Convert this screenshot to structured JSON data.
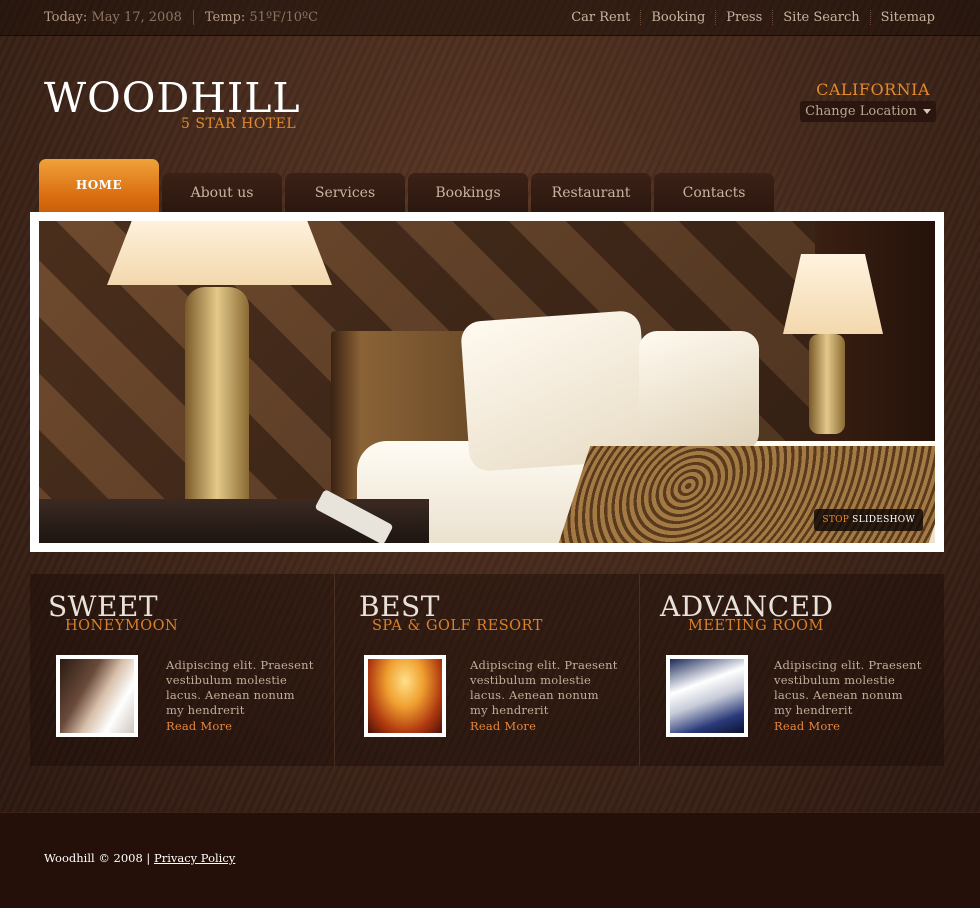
{
  "topbar": {
    "today_label": "Today:",
    "today_value": "May 17, 2008",
    "temp_label": "Temp:",
    "temp_value": "51ºF/10ºC",
    "links": [
      "Car Rent",
      "Booking",
      "Press",
      "Site Search",
      "Sitemap"
    ]
  },
  "logo": {
    "name": "WOODHILL",
    "tagline": "5 STAR HOTEL"
  },
  "location": {
    "state": "CALIFORNIA",
    "change_label": "Change Location"
  },
  "nav": {
    "tabs": [
      {
        "label": "HOME",
        "active": true
      },
      {
        "label": "About us"
      },
      {
        "label": "Services"
      },
      {
        "label": "Bookings"
      },
      {
        "label": "Restaurant"
      },
      {
        "label": "Contacts"
      }
    ]
  },
  "slideshow": {
    "stop_label": "STOP",
    "slideshow_label": "SLIDESHOW"
  },
  "features": [
    {
      "title": "SWEET",
      "subtitle": "HONEYMOON",
      "text": "Adipiscing elit. Praesent vestibulum molestie lacus. Aenean nonum my hendrerit",
      "link": "Read More"
    },
    {
      "title": "BEST",
      "subtitle": "SPA & GOLF RESORT",
      "text": "Adipiscing elit. Praesent vestibulum molestie lacus. Aenean nonum my hendrerit",
      "link": "Read More"
    },
    {
      "title": "ADVANCED",
      "subtitle": "MEETING ROOM",
      "text": "Adipiscing elit. Praesent vestibulum molestie lacus. Aenean nonum my hendrerit",
      "link": "Read More"
    }
  ],
  "footer": {
    "copyright": "Woodhill © 2008 |",
    "privacy": "Privacy Policy"
  },
  "colors": {
    "accent": "#e18a2e",
    "background": "#3a2216",
    "active_tab": "#d96d0f",
    "link": "#e9853a"
  }
}
